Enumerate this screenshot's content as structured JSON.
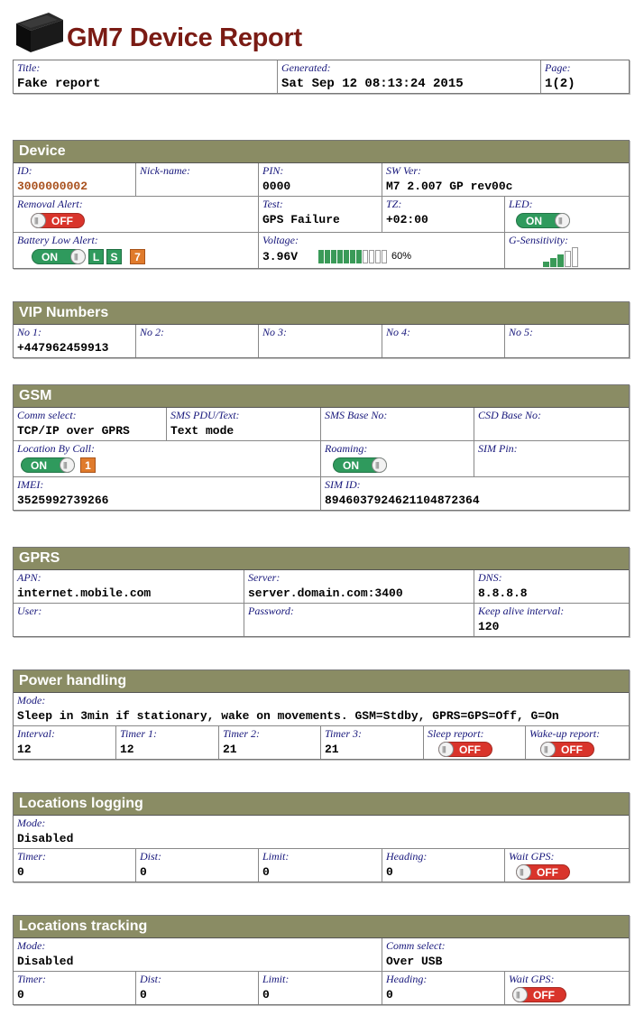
{
  "header": {
    "title": "GM7 Device Report"
  },
  "title_box": {
    "title_label": "Title:",
    "title_value": "Fake report",
    "generated_label": "Generated:",
    "generated_value": "Sat Sep 12 08:13:24 2015",
    "page_label": "Page:",
    "page_value": "1(2)"
  },
  "device": {
    "heading": "Device",
    "id_label": "ID:",
    "id_value": "3000000002",
    "nick_label": "Nick-name:",
    "pin_label": "PIN:",
    "pin_value": "0000",
    "sw_label": "SW Ver:",
    "sw_value": "M7 2.007 GP rev00c",
    "removal_label": "Removal Alert:",
    "removal_state": "OFF",
    "test_label": "Test:",
    "test_value": "GPS Failure",
    "tz_label": "TZ:",
    "tz_value": "+02:00",
    "led_label": "LED:",
    "led_state": "ON",
    "battery_label": "Battery Low Alert:",
    "battery_state": "ON",
    "battery_badges": [
      "L",
      "S",
      "7"
    ],
    "voltage_label": "Voltage:",
    "voltage_value": "3.96V",
    "voltage_percent": 60,
    "voltage_percent_text": "60%",
    "gsens_label": "G-Sensitivity:",
    "gsens_level": 3,
    "gsens_max": 5
  },
  "vip": {
    "heading": "VIP Numbers",
    "labels": [
      "No 1:",
      "No 2:",
      "No 3:",
      "No 4:",
      "No 5:"
    ],
    "values": [
      "+447962459913",
      "",
      "",
      "",
      ""
    ]
  },
  "gsm": {
    "heading": "GSM",
    "comm_label": "Comm select:",
    "comm_value": "TCP/IP over GPRS",
    "sms_pdu_label": "SMS PDU/Text:",
    "sms_pdu_value": "Text mode",
    "sms_base_label": "SMS Base No:",
    "csd_label": "CSD Base No:",
    "loc_call_label": "Location By Call:",
    "loc_call_state": "ON",
    "loc_call_badge": "1",
    "roaming_label": "Roaming:",
    "roaming_state": "ON",
    "sim_pin_label": "SIM Pin:",
    "imei_label": "IMEI:",
    "imei_value": "3525992739266",
    "simid_label": "SIM ID:",
    "simid_value": "8946037924621104872364"
  },
  "gprs": {
    "heading": "GPRS",
    "apn_label": "APN:",
    "apn_value": "internet.mobile.com",
    "server_label": "Server:",
    "server_value": "server.domain.com:3400",
    "dns_label": "DNS:",
    "dns_value": "8.8.8.8",
    "user_label": "User:",
    "password_label": "Password:",
    "keepalive_label": "Keep alive interval:",
    "keepalive_value": "120"
  },
  "power": {
    "heading": "Power handling",
    "mode_label": "Mode:",
    "mode_value": "Sleep in 3min if stationary, wake on movements. GSM=Stdby, GPRS=GPS=Off, G=On",
    "interval_label": "Interval:",
    "interval_value": "12",
    "timer1_label": "Timer 1:",
    "timer1_value": "12",
    "timer2_label": "Timer 2:",
    "timer2_value": "21",
    "timer3_label": "Timer 3:",
    "timer3_value": "21",
    "sleep_label": "Sleep report:",
    "sleep_state": "OFF",
    "wake_label": "Wake-up report:",
    "wake_state": "OFF"
  },
  "logging": {
    "heading": "Locations logging",
    "mode_label": "Mode:",
    "mode_value": "Disabled",
    "timer_label": "Timer:",
    "timer_value": "0",
    "dist_label": "Dist:",
    "dist_value": "0",
    "limit_label": "Limit:",
    "limit_value": "0",
    "heading_label": "Heading:",
    "heading_value": "0",
    "waitgps_label": "Wait GPS:",
    "waitgps_state": "OFF"
  },
  "tracking": {
    "heading": "Locations tracking",
    "mode_label": "Mode:",
    "mode_value": "Disabled",
    "comm_label": "Comm select:",
    "comm_value": "Over USB",
    "timer_label": "Timer:",
    "timer_value": "0",
    "dist_label": "Dist:",
    "dist_value": "0",
    "limit_label": "Limit:",
    "limit_value": "0",
    "heading_label": "Heading:",
    "heading_value": "0",
    "waitgps_label": "Wait GPS:",
    "waitgps_state": "OFF"
  },
  "colors": {
    "title_red": "#7a1b14",
    "section_bar": "#8a8c64",
    "label_blue": "#15157a",
    "id_orange": "#a8501c",
    "toggle_on": "#2f9a5d",
    "toggle_off": "#d9342b",
    "badge_orange": "#e07b2c"
  },
  "icons": {
    "logo": "device-box-icon"
  }
}
